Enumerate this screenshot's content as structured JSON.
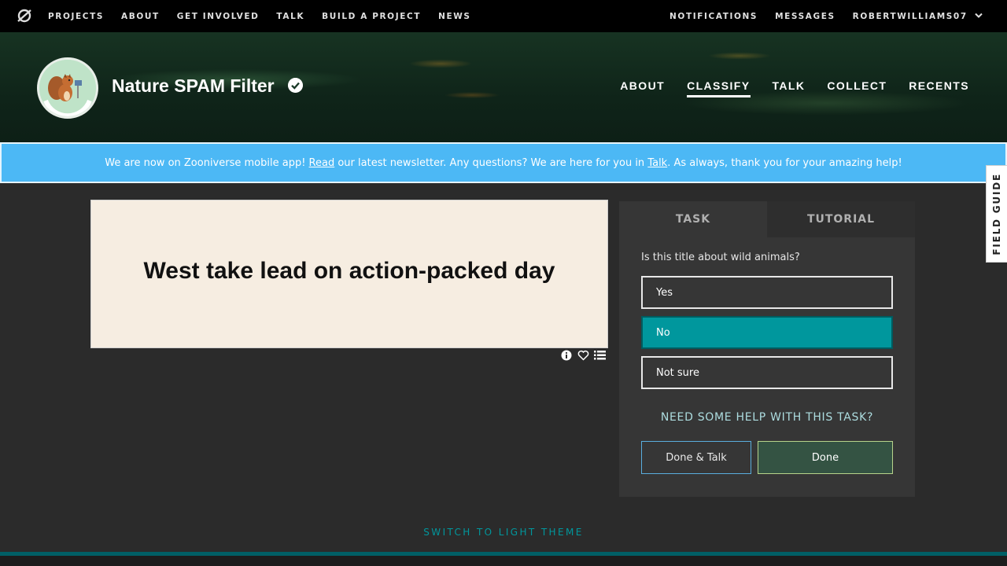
{
  "topnav": {
    "links": [
      "PROJECTS",
      "ABOUT",
      "GET INVOLVED",
      "TALK",
      "BUILD A PROJECT",
      "NEWS"
    ],
    "notifications": "NOTIFICATIONS",
    "messages": "MESSAGES",
    "username": "ROBERTWILLIAMS07"
  },
  "project": {
    "title": "Nature SPAM Filter",
    "nav": [
      "ABOUT",
      "CLASSIFY",
      "TALK",
      "COLLECT",
      "RECENTS"
    ],
    "active_nav": "CLASSIFY"
  },
  "banner": {
    "part1": "We are now on Zooniverse mobile app! ",
    "link1": "Read",
    "part2": " our latest newsletter. Any questions? We are here for you in ",
    "link2": "Talk",
    "part3": ". As always, thank you for your amazing help!"
  },
  "subject": {
    "text": "West take lead on action-packed day"
  },
  "task_panel": {
    "tab_task": "TASK",
    "tab_tutorial": "TUTORIAL",
    "question": "Is this title about wild animals?",
    "answers": [
      "Yes",
      "No",
      "Not sure"
    ],
    "selected_answer": "No",
    "help": "NEED SOME HELP WITH THIS TASK?",
    "done_talk": "Done & Talk",
    "done": "Done"
  },
  "field_guide": "FIELD GUIDE",
  "theme_switch": "SWITCH TO LIGHT THEME",
  "colors": {
    "accent": "#00979d",
    "banner": "#4cb8f5",
    "done": "#345343"
  }
}
